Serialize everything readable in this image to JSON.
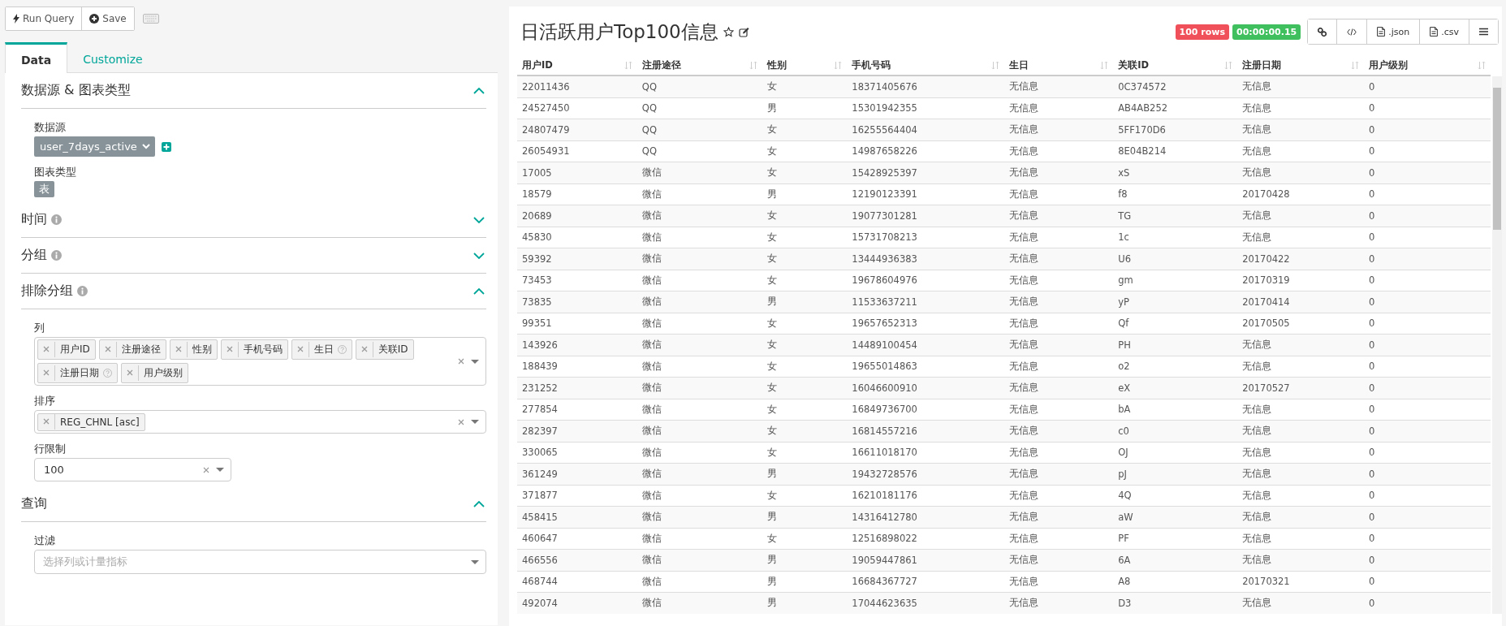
{
  "toolbar": {
    "buttons": [
      {
        "kind": "run",
        "label": "Run Query"
      },
      {
        "kind": "save",
        "label": "Save"
      }
    ]
  },
  "tabs": [
    {
      "label": "Data",
      "selected": true
    },
    {
      "label": "Customize",
      "selected": false
    }
  ],
  "sections": [
    {
      "title": "数据源 & 图表类型",
      "info": false,
      "expanded": true,
      "fields": [
        {
          "kind": "datasource",
          "label": "数据源",
          "value": "user_7days_active"
        },
        {
          "kind": "chip",
          "label": "图表类型",
          "value": "表"
        }
      ]
    },
    {
      "title": "时间",
      "info": true,
      "expanded": false
    },
    {
      "title": "分组",
      "info": true,
      "expanded": false
    },
    {
      "title": "排除分组",
      "info": true,
      "expanded": true,
      "fields": [
        {
          "kind": "tags",
          "label": "列",
          "clearable": true,
          "tags": [
            {
              "text": "用户ID",
              "help": false
            },
            {
              "text": "注册途径",
              "help": false
            },
            {
              "text": "性别",
              "help": false
            },
            {
              "text": "手机号码",
              "help": false
            },
            {
              "text": "生日",
              "help": true
            },
            {
              "text": "关联ID",
              "help": false
            },
            {
              "text": "注册日期",
              "help": true
            },
            {
              "text": "用户级别",
              "help": false
            }
          ]
        },
        {
          "kind": "tags",
          "label": "排序",
          "clearable": true,
          "tags": [
            {
              "text": "REG_CHNL [asc]",
              "help": false
            }
          ]
        },
        {
          "kind": "select",
          "label": "行限制",
          "value": "100",
          "clearable": true
        }
      ]
    },
    {
      "title": "查询",
      "info": false,
      "expanded": true,
      "fields": [
        {
          "kind": "tags",
          "label": "过滤",
          "clearable": false,
          "placeholder": "选择列或计量指标"
        }
      ]
    }
  ],
  "result": {
    "title": "日活跃用户Top100信息",
    "badges": [
      {
        "text": "100 rows",
        "color": "#f0505a"
      },
      {
        "text": "00:00:00.15",
        "color": "#40bf5f"
      }
    ],
    "actions": [
      {
        "kind": "link"
      },
      {
        "kind": "code"
      },
      {
        "kind": "file",
        "label": ".json"
      },
      {
        "kind": "file",
        "label": ".csv"
      },
      {
        "kind": "menu"
      }
    ],
    "table": {
      "columns": [
        "用户ID",
        "注册途径",
        "性别",
        "手机号码",
        "生日",
        "关联ID",
        "注册日期",
        "用户级别"
      ],
      "rows": [
        [
          "22011436",
          "QQ",
          "女",
          "18371405676",
          "无信息",
          "0C374572",
          "无信息",
          "0"
        ],
        [
          "24527450",
          "QQ",
          "男",
          "15301942355",
          "无信息",
          "AB4AB252",
          "无信息",
          "0"
        ],
        [
          "24807479",
          "QQ",
          "女",
          "16255564404",
          "无信息",
          "5FF170D6",
          "无信息",
          "0"
        ],
        [
          "26054931",
          "QQ",
          "女",
          "14987658226",
          "无信息",
          "8E04B214",
          "无信息",
          "0"
        ],
        [
          "17005",
          "微信",
          "女",
          "15428925397",
          "无信息",
          "xS",
          "无信息",
          "0"
        ],
        [
          "18579",
          "微信",
          "男",
          "12190123391",
          "无信息",
          "f8",
          "20170428",
          "0"
        ],
        [
          "20689",
          "微信",
          "女",
          "19077301281",
          "无信息",
          "TG",
          "无信息",
          "0"
        ],
        [
          "45830",
          "微信",
          "女",
          "15731708213",
          "无信息",
          "1c",
          "无信息",
          "0"
        ],
        [
          "59392",
          "微信",
          "女",
          "13444936383",
          "无信息",
          "U6",
          "20170422",
          "0"
        ],
        [
          "73453",
          "微信",
          "女",
          "19678604976",
          "无信息",
          "gm",
          "20170319",
          "0"
        ],
        [
          "73835",
          "微信",
          "男",
          "11533637211",
          "无信息",
          "yP",
          "20170414",
          "0"
        ],
        [
          "99351",
          "微信",
          "女",
          "19657652313",
          "无信息",
          "Qf",
          "20170505",
          "0"
        ],
        [
          "143926",
          "微信",
          "女",
          "14489100454",
          "无信息",
          "PH",
          "无信息",
          "0"
        ],
        [
          "188439",
          "微信",
          "女",
          "19655014863",
          "无信息",
          "o2",
          "无信息",
          "0"
        ],
        [
          "231252",
          "微信",
          "女",
          "16046600910",
          "无信息",
          "eX",
          "20170527",
          "0"
        ],
        [
          "277854",
          "微信",
          "女",
          "16849736700",
          "无信息",
          "bA",
          "无信息",
          "0"
        ],
        [
          "282397",
          "微信",
          "女",
          "16814557216",
          "无信息",
          "c0",
          "无信息",
          "0"
        ],
        [
          "330065",
          "微信",
          "女",
          "16611018170",
          "无信息",
          "OJ",
          "无信息",
          "0"
        ],
        [
          "361249",
          "微信",
          "男",
          "19432728576",
          "无信息",
          "pJ",
          "无信息",
          "0"
        ],
        [
          "371877",
          "微信",
          "女",
          "16210181176",
          "无信息",
          "4Q",
          "无信息",
          "0"
        ],
        [
          "458415",
          "微信",
          "男",
          "14316412780",
          "无信息",
          "aW",
          "无信息",
          "0"
        ],
        [
          "460647",
          "微信",
          "女",
          "12516898022",
          "无信息",
          "PF",
          "无信息",
          "0"
        ],
        [
          "466556",
          "微信",
          "男",
          "19059447861",
          "无信息",
          "6A",
          "无信息",
          "0"
        ],
        [
          "468744",
          "微信",
          "男",
          "16684367727",
          "无信息",
          "A8",
          "20170321",
          "0"
        ],
        [
          "492074",
          "微信",
          "男",
          "17044623635",
          "无信息",
          "D3",
          "无信息",
          "0"
        ]
      ]
    }
  }
}
